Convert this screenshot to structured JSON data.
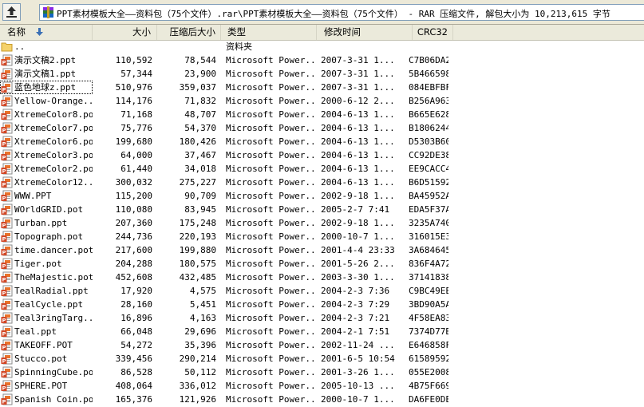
{
  "address_bar": {
    "path": "PPT素材模板大全——资料包（75个文件）.rar\\PPT素材模板大全——资料包（75个文件） - RAR 压缩文件, 解包大小为 10,213,615 字节"
  },
  "columns": {
    "name": "名称",
    "size": "大小",
    "packed": "压缩后大小",
    "type": "类型",
    "modified": "修改时间",
    "crc": "CRC32"
  },
  "rows": [
    {
      "name": "..",
      "size": "",
      "packed": "",
      "type": "资料夹",
      "modified": "",
      "crc": "",
      "icon": "folder-icon"
    },
    {
      "name": "演示文稿2.ppt",
      "size": "110,592",
      "packed": "78,544",
      "type": "Microsoft Power...",
      "modified": "2007-3-31 1...",
      "crc": "C7B06DA2",
      "icon": "ppt-icon"
    },
    {
      "name": "演示文稿1.ppt",
      "size": "57,344",
      "packed": "23,900",
      "type": "Microsoft Power...",
      "modified": "2007-3-31 1...",
      "crc": "5B466598",
      "icon": "ppt-icon"
    },
    {
      "name": "蓝色地球z.ppt",
      "size": "510,976",
      "packed": "359,037",
      "type": "Microsoft Power...",
      "modified": "2007-3-31 1...",
      "crc": "084EBFBF",
      "icon": "ppt-icon"
    },
    {
      "name": "Yellow-Orange...",
      "size": "114,176",
      "packed": "71,832",
      "type": "Microsoft Power...",
      "modified": "2000-6-12 2...",
      "crc": "B256A963",
      "icon": "ppt-icon"
    },
    {
      "name": "XtremeColor8.pot",
      "size": "71,168",
      "packed": "48,707",
      "type": "Microsoft Power...",
      "modified": "2004-6-13 1...",
      "crc": "B665E628",
      "icon": "ppt-icon"
    },
    {
      "name": "XtremeColor7.pot",
      "size": "75,776",
      "packed": "54,370",
      "type": "Microsoft Power...",
      "modified": "2004-6-13 1...",
      "crc": "B1806244",
      "icon": "ppt-icon"
    },
    {
      "name": "XtremeColor6.pot",
      "size": "199,680",
      "packed": "180,426",
      "type": "Microsoft Power...",
      "modified": "2004-6-13 1...",
      "crc": "D5303B60",
      "icon": "ppt-icon"
    },
    {
      "name": "XtremeColor3.pot",
      "size": "64,000",
      "packed": "37,467",
      "type": "Microsoft Power...",
      "modified": "2004-6-13 1...",
      "crc": "CC92DE38",
      "icon": "ppt-icon"
    },
    {
      "name": "XtremeColor2.pot",
      "size": "61,440",
      "packed": "34,018",
      "type": "Microsoft Power...",
      "modified": "2004-6-13 1...",
      "crc": "EE9CACC4",
      "icon": "ppt-icon"
    },
    {
      "name": "XtremeColor12...",
      "size": "300,032",
      "packed": "275,227",
      "type": "Microsoft Power...",
      "modified": "2004-6-13 1...",
      "crc": "B6D51592",
      "icon": "ppt-icon"
    },
    {
      "name": "WWW.PPT",
      "size": "115,200",
      "packed": "90,709",
      "type": "Microsoft Power...",
      "modified": "2002-9-18 1...",
      "crc": "BA45952A",
      "icon": "ppt-icon"
    },
    {
      "name": "WOrldGRID.pot",
      "size": "110,080",
      "packed": "83,945",
      "type": "Microsoft Power...",
      "modified": "2005-2-7 7:41",
      "crc": "EDA5F37A",
      "icon": "ppt-icon"
    },
    {
      "name": "Turban.ppt",
      "size": "207,360",
      "packed": "175,248",
      "type": "Microsoft Power...",
      "modified": "2002-9-18 1...",
      "crc": "3235A740",
      "icon": "ppt-icon"
    },
    {
      "name": "Topograph.pot",
      "size": "244,736",
      "packed": "220,193",
      "type": "Microsoft Power...",
      "modified": "2000-10-7 1...",
      "crc": "316015E3",
      "icon": "ppt-icon"
    },
    {
      "name": "time.dancer.pot",
      "size": "217,600",
      "packed": "199,880",
      "type": "Microsoft Power...",
      "modified": "2001-4-4 23:33",
      "crc": "3A684645",
      "icon": "ppt-icon"
    },
    {
      "name": "Tiger.pot",
      "size": "204,288",
      "packed": "180,575",
      "type": "Microsoft Power...",
      "modified": "2001-5-26 2...",
      "crc": "836F4A72",
      "icon": "ppt-icon"
    },
    {
      "name": "TheMajestic.pot",
      "size": "452,608",
      "packed": "432,485",
      "type": "Microsoft Power...",
      "modified": "2003-3-30 1...",
      "crc": "37141838",
      "icon": "ppt-icon"
    },
    {
      "name": "TealRadial.ppt",
      "size": "17,920",
      "packed": "4,575",
      "type": "Microsoft Power...",
      "modified": "2004-2-3 7:36",
      "crc": "C9BC49EE",
      "icon": "ppt-icon"
    },
    {
      "name": "TealCycle.ppt",
      "size": "28,160",
      "packed": "5,451",
      "type": "Microsoft Power...",
      "modified": "2004-2-3 7:29",
      "crc": "3BD90A5A",
      "icon": "ppt-icon"
    },
    {
      "name": "Teal3ringTarg...",
      "size": "16,896",
      "packed": "4,163",
      "type": "Microsoft Power...",
      "modified": "2004-2-3 7:21",
      "crc": "4F58EA83",
      "icon": "ppt-icon"
    },
    {
      "name": "Teal.ppt",
      "size": "66,048",
      "packed": "29,696",
      "type": "Microsoft Power...",
      "modified": "2004-2-1 7:51",
      "crc": "7374D77B",
      "icon": "ppt-icon"
    },
    {
      "name": "TAKEOFF.POT",
      "size": "54,272",
      "packed": "35,396",
      "type": "Microsoft Power...",
      "modified": "2002-11-24 ...",
      "crc": "E646858F",
      "icon": "ppt-icon"
    },
    {
      "name": "Stucco.pot",
      "size": "339,456",
      "packed": "290,214",
      "type": "Microsoft Power...",
      "modified": "2001-6-5 10:54",
      "crc": "61589592",
      "icon": "ppt-icon"
    },
    {
      "name": "SpinningCube.pot",
      "size": "86,528",
      "packed": "50,112",
      "type": "Microsoft Power...",
      "modified": "2001-3-26 1...",
      "crc": "055E2008",
      "icon": "ppt-icon"
    },
    {
      "name": "SPHERE.POT",
      "size": "408,064",
      "packed": "336,012",
      "type": "Microsoft Power...",
      "modified": "2005-10-13 ...",
      "crc": "4B75F669",
      "icon": "ppt-icon"
    },
    {
      "name": "Spanish Coin.pot",
      "size": "165,376",
      "packed": "121,926",
      "type": "Microsoft Power...",
      "modified": "2000-10-7 1...",
      "crc": "DA6FE0DE",
      "icon": "ppt-icon"
    }
  ],
  "focused_row_index": 3
}
